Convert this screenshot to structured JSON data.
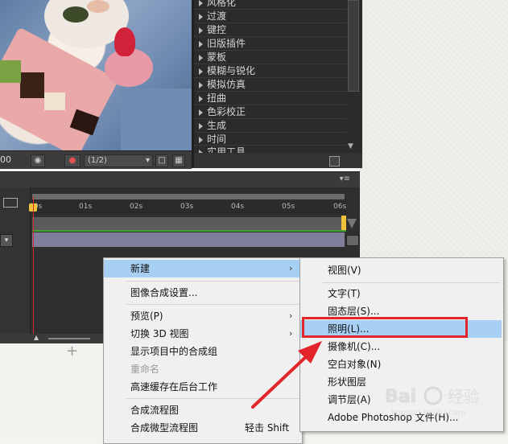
{
  "effects_panel": {
    "categories": [
      "风格化",
      "过渡",
      "键控",
      "旧版插件",
      "蒙板",
      "模糊与锐化",
      "模拟仿真",
      "扭曲",
      "色彩校正",
      "生成",
      "时间",
      "实用工具"
    ]
  },
  "viewer": {
    "timecode": "00",
    "resolution": "(1/2)"
  },
  "timeline": {
    "ticks": [
      "00s",
      "01s",
      "02s",
      "03s",
      "04s",
      "05s",
      "06s"
    ]
  },
  "context_menu": {
    "items": [
      {
        "label": "新建",
        "submenu": true,
        "selected": true
      },
      {
        "label": "图像合成设置..."
      },
      {
        "label": "预览(P)",
        "submenu": true
      },
      {
        "label": "切换 3D 视图",
        "submenu": true
      },
      {
        "label": "显示项目中的合成组"
      },
      {
        "label": "重命名",
        "disabled": true
      },
      {
        "label": "高速缓存在后台工作"
      },
      {
        "label": "合成流程图"
      },
      {
        "label": "合成微型流程图",
        "shortcut": "轻击 Shift"
      }
    ]
  },
  "submenu_new": {
    "items": [
      {
        "label": "视图(V)"
      },
      {
        "label": "文字(T)"
      },
      {
        "label": "固态层(S)..."
      },
      {
        "label": "照明(L)...",
        "selected": true
      },
      {
        "label": "摄像机(C)..."
      },
      {
        "label": "空白对象(N)"
      },
      {
        "label": "形状图层"
      },
      {
        "label": "调节层(A)"
      },
      {
        "label": "Adobe Photoshop 文件(H)..."
      }
    ]
  },
  "colors": {
    "annotation": "#e2252a",
    "menu_highlight": "#a8d0f5",
    "playhead": "#d22a2a"
  },
  "watermark": "Bai 经验 jingyan.baidu.com"
}
